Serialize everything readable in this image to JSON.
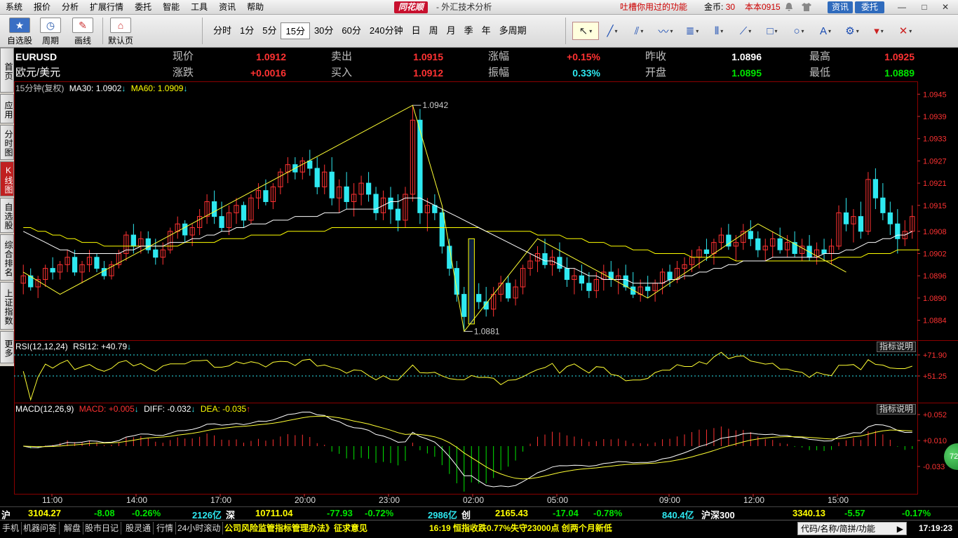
{
  "menu": {
    "items": [
      "系统",
      "报价",
      "分析",
      "扩展行情",
      "委托",
      "智能",
      "工具",
      "资讯",
      "帮助"
    ],
    "logo": "同花顺",
    "app_title": "- 外汇技术分析",
    "slogan": "吐槽你用过的功能",
    "coins_label": "金币:",
    "coins_value": "30",
    "version": "本本0915",
    "info_btn": "资讯",
    "trade_btn": "委托",
    "window_controls": [
      "—",
      "□",
      "✕"
    ]
  },
  "toolbar": {
    "big_buttons": [
      "自选股",
      "周期",
      "画线",
      "默认页"
    ],
    "periods": [
      "分时",
      "1分",
      "5分",
      "15分",
      "30分",
      "60分",
      "240分钟",
      "日",
      "周",
      "月",
      "季",
      "年",
      "多周期"
    ],
    "active_period": "15分",
    "draw_tools": [
      "pointer-icon",
      "line-tool-icon",
      "parallel-line-icon",
      "wave-icon",
      "fibonacci-icon",
      "bar-icon",
      "channel-icon",
      "rectangle-icon",
      "ellipse-icon",
      "text-tool-icon",
      "settings-icon",
      "bookmark-icon",
      "delete-icon"
    ]
  },
  "side_tabs": [
    {
      "label": "首页",
      "active": false
    },
    {
      "label": "应用",
      "active": false
    },
    {
      "label": "分时图",
      "active": false
    },
    {
      "label": "K线图",
      "active": true
    },
    {
      "label": "自选股",
      "active": false
    },
    {
      "label": "综合排名",
      "active": false
    },
    {
      "label": "上证指数",
      "active": false
    },
    {
      "label": "更多",
      "active": false
    }
  ],
  "quote": {
    "symbol": "EURUSD",
    "name": "欧元/美元",
    "rows": [
      [
        {
          "label": "现价",
          "value": "1.0912"
        },
        {
          "label": "卖出",
          "value": "1.0915"
        },
        {
          "label": "涨幅",
          "value": "+0.15%"
        },
        {
          "label": "昨收",
          "value": "1.0896"
        },
        {
          "label": "最高",
          "value": "1.0925"
        }
      ],
      [
        {
          "label": "涨跌",
          "value": "+0.0016"
        },
        {
          "label": "买入",
          "value": "1.0912"
        },
        {
          "label": "振幅",
          "value": "0.33%"
        },
        {
          "label": "开盘",
          "value": "1.0895"
        },
        {
          "label": "最低",
          "value": "1.0889"
        }
      ]
    ]
  },
  "main_panel": {
    "caption": "15分钟(复权)",
    "ma30_label": "MA30: 1.0902",
    "ma60_label": "MA60: 1.0909",
    "high_marker": "1.0942",
    "low_marker": "1.0881"
  },
  "rsi_panel": {
    "caption": "RSI(12,12,24)",
    "rsi_label": "RSI12: +40.79",
    "help": "指标说明",
    "levels": [
      "+71.90",
      "+51.25"
    ]
  },
  "macd_panel": {
    "caption": "MACD(12,26,9)",
    "macd_label": "MACD: +0.005",
    "diff_label": "DIFF: -0.032",
    "dea_label": "DEA: -0.035",
    "help": "指标说明",
    "levels": [
      "+0.052",
      "+0.010",
      "-0.033"
    ]
  },
  "time_axis": [
    "11:00",
    "14:00",
    "17:00",
    "20:00",
    "23:00",
    "02:00",
    "05:00",
    "09:00",
    "12:00",
    "15:00"
  ],
  "colors": {
    "up": "#ff3232",
    "down": "#2ee8f0",
    "ma30": "#ffffff",
    "ma60": "#ffff00",
    "grid": "#8b0000"
  },
  "chart_data": {
    "type": "candlestick",
    "ylim": [
      1.0879,
      1.0946
    ],
    "y_ticks": [
      1.0945,
      1.0939,
      1.0933,
      1.0927,
      1.0921,
      1.0915,
      1.0908,
      1.0902,
      1.0896,
      1.089,
      1.0884
    ],
    "ohlc": [
      [
        1.0894,
        1.0899,
        1.0891,
        1.0896
      ],
      [
        1.0896,
        1.0898,
        1.0892,
        1.0893
      ],
      [
        1.0893,
        1.0896,
        1.089,
        1.0895
      ],
      [
        1.0895,
        1.0899,
        1.0893,
        1.0898
      ],
      [
        1.0898,
        1.0901,
        1.0895,
        1.0897
      ],
      [
        1.0897,
        1.09,
        1.0895,
        1.0899
      ],
      [
        1.0899,
        1.0903,
        1.0897,
        1.0901
      ],
      [
        1.0901,
        1.0903,
        1.0896,
        1.0897
      ],
      [
        1.0897,
        1.09,
        1.0894,
        1.0899
      ],
      [
        1.0899,
        1.0903,
        1.0897,
        1.0901
      ],
      [
        1.0901,
        1.0902,
        1.0897,
        1.0898
      ],
      [
        1.0898,
        1.09,
        1.0895,
        1.0896
      ],
      [
        1.0896,
        1.09,
        1.0895,
        1.0899
      ],
      [
        1.0899,
        1.0903,
        1.0898,
        1.0902
      ],
      [
        1.0902,
        1.0908,
        1.09,
        1.0907
      ],
      [
        1.0907,
        1.091,
        1.0902,
        1.0904
      ],
      [
        1.0904,
        1.0908,
        1.0902,
        1.0906
      ],
      [
        1.0906,
        1.0908,
        1.0902,
        1.0903
      ],
      [
        1.0903,
        1.0906,
        1.0899,
        1.0901
      ],
      [
        1.0901,
        1.0905,
        1.0899,
        1.0903
      ],
      [
        1.0903,
        1.0909,
        1.0902,
        1.0908
      ],
      [
        1.0908,
        1.0912,
        1.0906,
        1.091
      ],
      [
        1.091,
        1.0911,
        1.0905,
        1.0907
      ],
      [
        1.0907,
        1.091,
        1.0904,
        1.0909
      ],
      [
        1.0909,
        1.0914,
        1.0907,
        1.0912
      ],
      [
        1.0912,
        1.0918,
        1.091,
        1.0916
      ],
      [
        1.0916,
        1.0919,
        1.091,
        1.0912
      ],
      [
        1.0912,
        1.0916,
        1.0908,
        1.0909
      ],
      [
        1.0909,
        1.0915,
        1.0907,
        1.0913
      ],
      [
        1.0913,
        1.0917,
        1.091,
        1.0915
      ],
      [
        1.0915,
        1.0916,
        1.0909,
        1.0911
      ],
      [
        1.0911,
        1.0918,
        1.091,
        1.0917
      ],
      [
        1.0917,
        1.0921,
        1.0914,
        1.0919
      ],
      [
        1.0919,
        1.0922,
        1.0915,
        1.0916
      ],
      [
        1.0916,
        1.0921,
        1.0914,
        1.092
      ],
      [
        1.092,
        1.0925,
        1.0918,
        1.0924
      ],
      [
        1.0924,
        1.0928,
        1.0921,
        1.0926
      ],
      [
        1.0926,
        1.0928,
        1.0922,
        1.0924
      ],
      [
        1.0924,
        1.0928,
        1.0922,
        1.0927
      ],
      [
        1.0927,
        1.093,
        1.0923,
        1.0925
      ],
      [
        1.0925,
        1.0928,
        1.0918,
        1.092
      ],
      [
        1.092,
        1.0926,
        1.0918,
        1.0924
      ],
      [
        1.0924,
        1.0928,
        1.0915,
        1.0917
      ],
      [
        1.0917,
        1.0922,
        1.0913,
        1.092
      ],
      [
        1.092,
        1.0924,
        1.0914,
        1.0916
      ],
      [
        1.0916,
        1.0921,
        1.0912,
        1.0918
      ],
      [
        1.0918,
        1.0923,
        1.0915,
        1.0921
      ],
      [
        1.0921,
        1.0924,
        1.0916,
        1.0918
      ],
      [
        1.0918,
        1.092,
        1.0911,
        1.0913
      ],
      [
        1.0913,
        1.0919,
        1.0911,
        1.0917
      ],
      [
        1.0917,
        1.092,
        1.091,
        1.0914
      ],
      [
        1.0914,
        1.0918,
        1.0908,
        1.0911
      ],
      [
        1.0911,
        1.092,
        1.0909,
        1.0918
      ],
      [
        1.0918,
        1.0942,
        1.0916,
        1.0938
      ],
      [
        1.0938,
        1.0941,
        1.091,
        1.0913
      ],
      [
        1.0913,
        1.0917,
        1.0908,
        1.0915
      ],
      [
        1.0915,
        1.0918,
        1.0911,
        1.0913
      ],
      [
        1.0913,
        1.0914,
        1.0902,
        1.0904
      ],
      [
        1.0904,
        1.0906,
        1.0896,
        1.0898
      ],
      [
        1.0898,
        1.09,
        1.0889,
        1.0891
      ],
      [
        1.0891,
        1.0893,
        1.0881,
        1.0885
      ],
      [
        1.0885,
        1.0902,
        1.0883,
        1.0901
      ],
      [
        1.0891,
        1.0894,
        1.0887,
        1.0889
      ],
      [
        1.0889,
        1.0893,
        1.0885,
        1.0887
      ],
      [
        1.0887,
        1.0893,
        1.0885,
        1.0891
      ],
      [
        1.0891,
        1.0896,
        1.0889,
        1.0894
      ],
      [
        1.0894,
        1.0896,
        1.0889,
        1.089
      ],
      [
        1.089,
        1.0895,
        1.0888,
        1.0893
      ],
      [
        1.0893,
        1.0899,
        1.0891,
        1.0898
      ],
      [
        1.0898,
        1.0902,
        1.0896,
        1.09
      ],
      [
        1.09,
        1.0904,
        1.0897,
        1.0902
      ],
      [
        1.0902,
        1.0906,
        1.0898,
        1.0899
      ],
      [
        1.0899,
        1.0903,
        1.0896,
        1.0901
      ],
      [
        1.0901,
        1.0905,
        1.0897,
        1.0898
      ],
      [
        1.0898,
        1.0901,
        1.0893,
        1.0895
      ],
      [
        1.0895,
        1.0898,
        1.0891,
        1.0896
      ],
      [
        1.0896,
        1.0899,
        1.0892,
        1.0894
      ],
      [
        1.0894,
        1.0897,
        1.089,
        1.0892
      ],
      [
        1.0892,
        1.0897,
        1.089,
        1.0895
      ],
      [
        1.0895,
        1.0899,
        1.0892,
        1.0897
      ],
      [
        1.0897,
        1.09,
        1.0893,
        1.0895
      ],
      [
        1.0895,
        1.0898,
        1.0891,
        1.0896
      ],
      [
        1.0896,
        1.0899,
        1.0892,
        1.0893
      ],
      [
        1.0893,
        1.0897,
        1.089,
        1.0891
      ],
      [
        1.0891,
        1.0895,
        1.0889,
        1.0893
      ],
      [
        1.0893,
        1.0896,
        1.089,
        1.0892
      ],
      [
        1.0892,
        1.0895,
        1.0889,
        1.0894
      ],
      [
        1.0894,
        1.0898,
        1.0891,
        1.0897
      ],
      [
        1.0897,
        1.0899,
        1.0893,
        1.0895
      ],
      [
        1.0895,
        1.09,
        1.0894,
        1.0898
      ],
      [
        1.0898,
        1.0901,
        1.0895,
        1.0899
      ],
      [
        1.0899,
        1.0903,
        1.0897,
        1.0901
      ],
      [
        1.0901,
        1.0904,
        1.0898,
        1.0903
      ],
      [
        1.0903,
        1.0906,
        1.09,
        1.0902
      ],
      [
        1.0902,
        1.0906,
        1.0899,
        1.0905
      ],
      [
        1.0905,
        1.0909,
        1.0903,
        1.0907
      ],
      [
        1.0907,
        1.091,
        1.0903,
        1.0904
      ],
      [
        1.0904,
        1.0907,
        1.09,
        1.0905
      ],
      [
        1.0905,
        1.091,
        1.0903,
        1.0908
      ],
      [
        1.0908,
        1.0911,
        1.0904,
        1.0906
      ],
      [
        1.0906,
        1.0908,
        1.0901,
        1.0903
      ],
      [
        1.0903,
        1.0906,
        1.09,
        1.0904
      ],
      [
        1.0904,
        1.0908,
        1.0901,
        1.0906
      ],
      [
        1.0906,
        1.0909,
        1.0902,
        1.0903
      ],
      [
        1.0903,
        1.0907,
        1.0901,
        1.0905
      ],
      [
        1.0905,
        1.0908,
        1.0901,
        1.0902
      ],
      [
        1.0902,
        1.0906,
        1.09,
        1.0904
      ],
      [
        1.0904,
        1.0907,
        1.09,
        1.0901
      ],
      [
        1.0901,
        1.0905,
        1.0899,
        1.0903
      ],
      [
        1.0903,
        1.0906,
        1.09,
        1.0902
      ],
      [
        1.0902,
        1.0906,
        1.0899,
        1.0904
      ],
      [
        1.0904,
        1.0915,
        1.0903,
        1.0913
      ],
      [
        1.0913,
        1.0917,
        1.0908,
        1.091
      ],
      [
        1.091,
        1.0914,
        1.0905,
        1.0912
      ],
      [
        1.0912,
        1.0916,
        1.0906,
        1.0908
      ],
      [
        1.0908,
        1.0924,
        1.0907,
        1.0922
      ],
      [
        1.0922,
        1.0925,
        1.0914,
        1.0917
      ],
      [
        1.0917,
        1.0921,
        1.0911,
        1.0913
      ],
      [
        1.0913,
        1.0916,
        1.0907,
        1.091
      ],
      [
        1.091,
        1.0914,
        1.0902,
        1.0906
      ],
      [
        1.0906,
        1.0911,
        1.0904,
        1.0908
      ],
      [
        1.0908,
        1.0915,
        1.0906,
        1.0912
      ]
    ],
    "ma30": [
      1.0908,
      1.0907,
      1.0906,
      1.0905,
      1.0904,
      1.0903,
      1.0903,
      1.0902,
      1.0902,
      1.0902,
      1.0902,
      1.0902,
      1.0902,
      1.0902,
      1.0903,
      1.0903,
      1.0904,
      1.0904,
      1.0904,
      1.0904,
      1.0905,
      1.0905,
      1.0905,
      1.0906,
      1.0906,
      1.0907,
      1.0907,
      1.0908,
      1.0908,
      1.0909,
      1.0909,
      1.091,
      1.091,
      1.091,
      1.0911,
      1.0911,
      1.0911,
      1.0912,
      1.0912,
      1.0912,
      1.0912,
      1.0913,
      1.0913,
      1.0913,
      1.0914,
      1.0914,
      1.0914,
      1.0914,
      1.0914,
      1.0915,
      1.0916,
      1.0916,
      1.0917,
      1.0917,
      1.0917,
      1.0916,
      1.0915,
      1.0914,
      1.0913,
      1.0912,
      1.0911,
      1.091,
      1.0909,
      1.0908,
      1.0907,
      1.0906,
      1.0905,
      1.0904,
      1.0903,
      1.0902,
      1.0901,
      1.09,
      1.09,
      1.0899,
      1.0898,
      1.0898,
      1.0897,
      1.0896,
      1.0896,
      1.0895,
      1.0895,
      1.0895,
      1.0895,
      1.0894,
      1.0894,
      1.0894,
      1.0894,
      1.0894,
      1.0895,
      1.0895,
      1.0896,
      1.0896,
      1.0897,
      1.0897,
      1.0898,
      1.0898,
      1.0899,
      1.0899,
      1.09,
      1.09,
      1.09,
      1.09,
      1.0901,
      1.0901,
      1.0901,
      1.0901,
      1.0901,
      1.0901,
      1.0901,
      1.0902,
      1.0902,
      1.0902,
      1.0903,
      1.0903,
      1.0904,
      1.0905,
      1.0905,
      1.0906,
      1.0906,
      1.0907,
      1.0907,
      1.0908
    ],
    "ma60": [
      1.0909,
      1.0909,
      1.0908,
      1.0908,
      1.0907,
      1.0907,
      1.0906,
      1.0906,
      1.0905,
      1.0905,
      1.0905,
      1.0904,
      1.0904,
      1.0904,
      1.0904,
      1.0904,
      1.0904,
      1.0904,
      1.0904,
      1.0904,
      1.0904,
      1.0904,
      1.0905,
      1.0905,
      1.0905,
      1.0905,
      1.0905,
      1.0906,
      1.0906,
      1.0906,
      1.0906,
      1.0907,
      1.0907,
      1.0907,
      1.0907,
      1.0907,
      1.0908,
      1.0908,
      1.0908,
      1.0908,
      1.0908,
      1.0908,
      1.0909,
      1.0909,
      1.0909,
      1.0909,
      1.0909,
      1.0909,
      1.0909,
      1.0909,
      1.0909,
      1.0909,
      1.0909,
      1.0909,
      1.0909,
      1.0909,
      1.0909,
      1.0909,
      1.0909,
      1.0909,
      1.0909,
      1.0909,
      1.0909,
      1.0908,
      1.0908,
      1.0908,
      1.0908,
      1.0908,
      1.0908,
      1.0908,
      1.0907,
      1.0907,
      1.0907,
      1.0907,
      1.0906,
      1.0906,
      1.0906,
      1.0905,
      1.0905,
      1.0905,
      1.0904,
      1.0904,
      1.0904,
      1.0903,
      1.0903,
      1.0903,
      1.0902,
      1.0902,
      1.0902,
      1.0902,
      1.0902,
      1.0901,
      1.0901,
      1.0901,
      1.0901,
      1.0901,
      1.0901,
      1.09,
      1.09,
      1.09,
      1.09,
      1.09,
      1.09,
      1.09,
      1.09,
      1.09,
      1.09,
      1.09,
      1.09,
      1.09,
      1.09,
      1.0901,
      1.0901,
      1.0901,
      1.0901,
      1.0902,
      1.0902,
      1.0902,
      1.0902,
      1.0903,
      1.0903,
      1.0903,
      1.0903
    ]
  }
}
